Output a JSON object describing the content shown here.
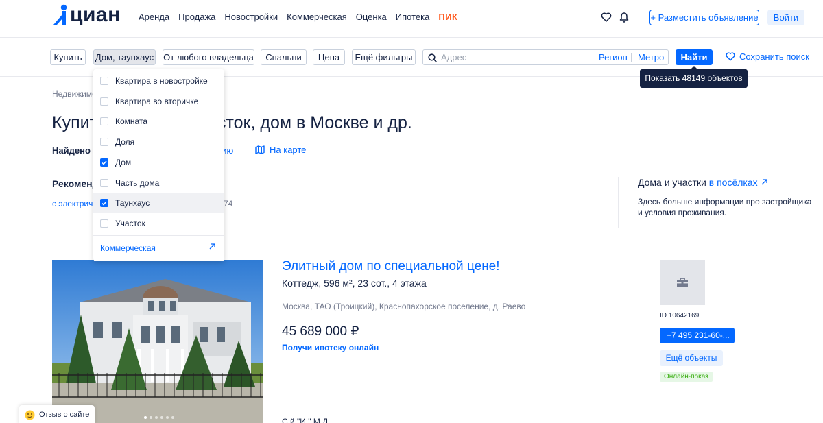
{
  "header": {
    "logo_text": "циан",
    "nav": [
      "Аренда",
      "Продажа",
      "Новостройки",
      "Коммерческая",
      "Оценка",
      "Ипотека",
      "ПИК"
    ],
    "place_ad": "+ Разместить объявление",
    "login": "Войти",
    "brand_color": "#0468ff"
  },
  "filters": {
    "buy": "Купить",
    "type": "Дом, таунхаус",
    "owner": "От любого владельца",
    "bedrooms": "Спальни",
    "price": "Цена",
    "more": "Ещё фильтры",
    "search_placeholder": "Адрес",
    "region": "Регион",
    "metro": "Метро",
    "find": "Найти",
    "save_search": "Сохранить поиск"
  },
  "tooltip": "Показать 48149 объектов",
  "dropdown": {
    "items": [
      {
        "label": "Квартира в новостройке",
        "checked": false
      },
      {
        "label": "Квартира во вторичке",
        "checked": false
      },
      {
        "label": "Комната",
        "checked": false
      },
      {
        "label": "Доля",
        "checked": false
      },
      {
        "label": "Дом",
        "checked": true
      },
      {
        "label": "Часть дома",
        "checked": false
      },
      {
        "label": "Таунхаус",
        "checked": true
      },
      {
        "label": "Участок",
        "checked": false
      }
    ],
    "commercial": "Коммерческая"
  },
  "content": {
    "breadcrumb": "Недвижимо",
    "title": "Купить таунхаус, участок, дом в Москве и др.",
    "found": "Найдено 93",
    "found_link": "нию",
    "map_link": "На карте",
    "reco_title": "Рекомендо",
    "reco_link": "с электрич",
    "reco_count": "74"
  },
  "side": {
    "title": "Дома и участки",
    "link": "в посёлках",
    "text": "Здесь больше информации про застройщика и условия проживания."
  },
  "listing": {
    "title": "Элитный дом по специальной цене!",
    "subtitle": "Коттедж, 596 м², 23 сот., 4 этажа",
    "address": "Москва, ТАО (Троицкий), Краснопахорское поселение, д. Раево",
    "price": "45 689 000 ₽",
    "mortgage": "Получи ипотеку онлайн",
    "description": "С                                                                    й                                                                        \"И                    \" М             Д",
    "id": "ID 10642169",
    "phone": "+7 495 231-60-...",
    "more_objects": "Ещё объекты",
    "online_badge": "Онлайн-показ"
  },
  "feedback": "Отзыв о сайте"
}
